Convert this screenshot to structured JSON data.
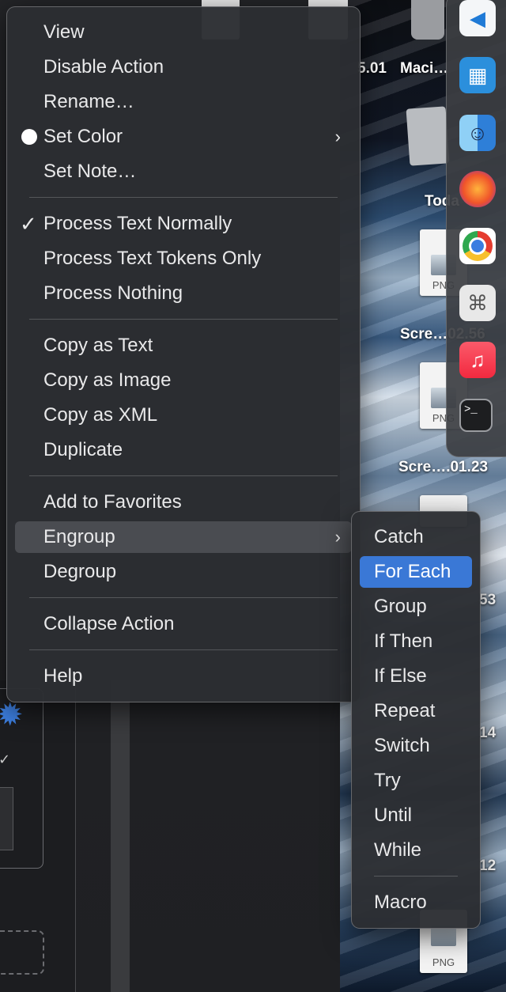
{
  "context_menu": {
    "items": [
      {
        "label": "View"
      },
      {
        "label": "Disable Action"
      },
      {
        "label": "Rename…"
      },
      {
        "label": "Set Color"
      },
      {
        "label": "Set Note…"
      },
      {
        "label": "Process Text Normally",
        "checked": true
      },
      {
        "label": "Process Text Tokens Only"
      },
      {
        "label": "Process Nothing"
      },
      {
        "label": "Copy as Text"
      },
      {
        "label": "Copy as Image"
      },
      {
        "label": "Copy as XML"
      },
      {
        "label": "Duplicate"
      },
      {
        "label": "Add to Favorites"
      },
      {
        "label": "Engroup",
        "highlighted": true
      },
      {
        "label": "Degroup"
      },
      {
        "label": "Collapse Action"
      },
      {
        "label": "Help"
      }
    ]
  },
  "engroup_submenu": {
    "items": [
      {
        "label": "Catch"
      },
      {
        "label": "For Each",
        "selected": true
      },
      {
        "label": "Group"
      },
      {
        "label": "If Then"
      },
      {
        "label": "If Else"
      },
      {
        "label": "Repeat"
      },
      {
        "label": "Switch"
      },
      {
        "label": "Try"
      },
      {
        "label": "Until"
      },
      {
        "label": "While"
      },
      {
        "label": "Macro"
      }
    ]
  },
  "desktop": {
    "labels": [
      "5.01",
      "Maci…",
      "Toda",
      "Scre…02.56",
      "Scre….01.23",
      "53",
      "14",
      "12"
    ],
    "png_ext": "PNG"
  },
  "dock": {
    "icons": [
      "vscode-icon",
      "docker-icon",
      "finder-icon",
      "firefox-icon",
      "chrome-icon",
      "script-editor-icon",
      "music-icon",
      "terminal-icon"
    ]
  },
  "colors": {
    "accent": "#3a78d6",
    "menu_bg": "#2c2e32",
    "hover": "#4a4c51"
  }
}
